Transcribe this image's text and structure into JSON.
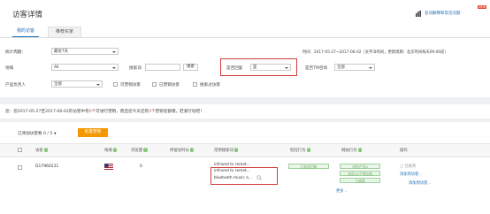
{
  "header": {
    "title": "访客详情",
    "top_right_link": "名词解释和常见问题",
    "new_badge": "NEW",
    "icon": "bar-chart-icon"
  },
  "tabs": [
    {
      "label": "我的访客",
      "active": true
    },
    {
      "label": "推荐买家",
      "active": false
    }
  ],
  "filters": {
    "period_label": "统计周期：",
    "period_value": "最近7天",
    "time_info": "时间：2017-05-27~2017-06-02（太平洋时间，更新周期：北京时间每天09:00前）",
    "region_label": "地域",
    "region_value": "All",
    "keyword_label": "搜索词",
    "keyword_value": "",
    "search_button": "搜索",
    "replied_label": "是否回复",
    "replied_value": "是",
    "tm_label": "是否TM咨询",
    "tm_value": "全部",
    "owner_label": "产品负责人",
    "owner_value": "全部",
    "checkbox_marketable": "可营销访客",
    "checkbox_marketed": "已营销访客",
    "checkbox_followed": "搜索过访客"
  },
  "notice": {
    "prefix": "您：您2017-05-27至2017-06-02的访客中有",
    "count1": "0",
    "middle": "个可进行营销，而且您今天还有",
    "count2": "0",
    "suffix": "个营销名额哦，赶紧行动吧！"
  },
  "toolbar": {
    "added_marketing": "已添加访客数 0 / 5",
    "batch_button": "批量营销"
  },
  "table": {
    "headers": [
      "访客",
      "地域",
      "浏览量",
      "停留总时长",
      "常用搜索词",
      "旺旺行为",
      "网站行为",
      "操作"
    ],
    "row": {
      "visitor_id": "D17960231",
      "flag_colors": [
        "#b22234",
        "#ffffff",
        "#3c3b6e"
      ],
      "views": "0",
      "search_terms": [
        "infrared tv remot...",
        "infrared tv remot...",
        "bluetooth music a..."
      ],
      "ww_tag": "已发起回复",
      "site_tags": [
        "浏览产品0",
        "浏览10个供应商",
        "已询盘"
      ],
      "ops": [
        "已联系",
        "添加到访客",
        "添加到访客"
      ],
      "more": "更多"
    }
  }
}
